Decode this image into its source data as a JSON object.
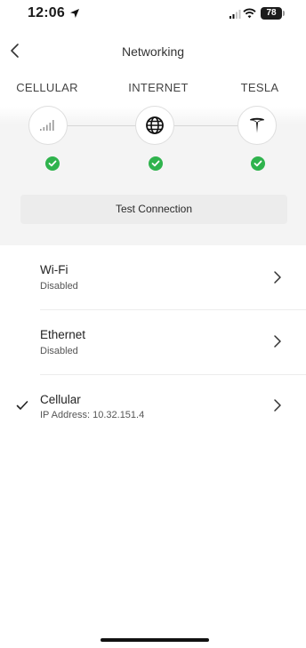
{
  "status_bar": {
    "time": "12:06",
    "battery": "78"
  },
  "header": {
    "title": "Networking"
  },
  "connection": {
    "nodes": [
      {
        "label": "CELLULAR",
        "icon": "cellular-signal-icon",
        "status": "ok"
      },
      {
        "label": "INTERNET",
        "icon": "globe-icon",
        "status": "ok"
      },
      {
        "label": "TESLA",
        "icon": "tesla-logo-icon",
        "status": "ok"
      }
    ],
    "status_color": "#2fb34d",
    "test_button_label": "Test Connection"
  },
  "networks": [
    {
      "title": "Wi-Fi",
      "subtitle": "Disabled",
      "selected": false
    },
    {
      "title": "Ethernet",
      "subtitle": "Disabled",
      "selected": false
    },
    {
      "title": "Cellular",
      "subtitle": "IP Address: 10.32.151.4",
      "selected": true
    }
  ]
}
